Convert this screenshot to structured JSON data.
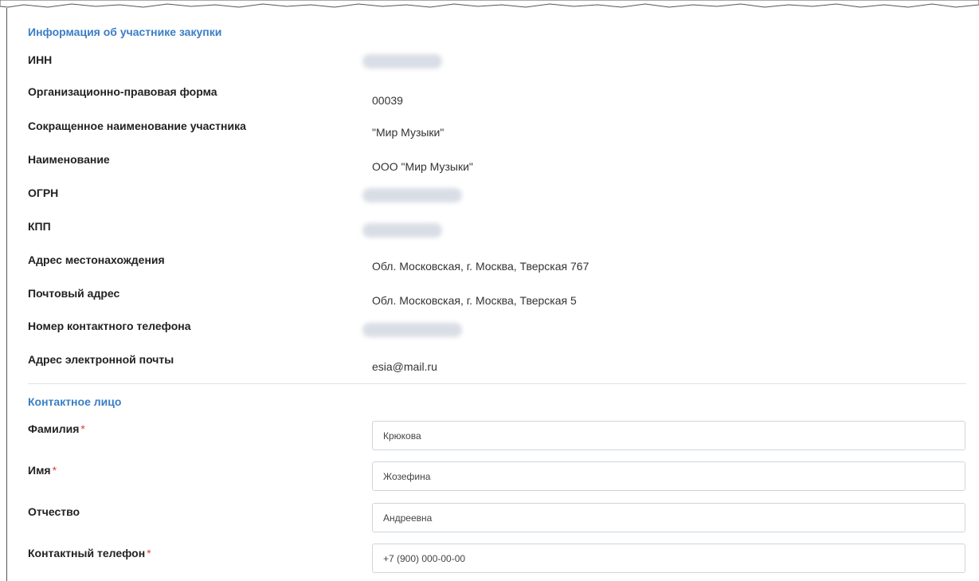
{
  "participant_section": {
    "title": "Информация об участнике закупки",
    "rows": [
      {
        "label": "ИНН",
        "value": "",
        "blurred": true
      },
      {
        "label": "Организационно-правовая форма",
        "value": "00039"
      },
      {
        "label": "Сокращенное наименование участника",
        "value": "\"Мир Музыки\""
      },
      {
        "label": "Наименование",
        "value": "ООО \"Мир Музыки\""
      },
      {
        "label": "ОГРН",
        "value": "",
        "blurred": true
      },
      {
        "label": "КПП",
        "value": "",
        "blurred": true
      },
      {
        "label": "Адрес местонахождения",
        "value": "Обл. Московская, г. Москва, Тверская 767"
      },
      {
        "label": "Почтовый адрес",
        "value": "Обл. Московская, г. Москва, Тверская 5"
      },
      {
        "label": "Номер контактного телефона",
        "value": "",
        "blurred": true
      },
      {
        "label": "Адрес электронной почты",
        "value": "esia@mail.ru"
      }
    ]
  },
  "contact_section": {
    "title": "Контактное лицо",
    "required_mark": "*",
    "fields": [
      {
        "label": "Фамилия",
        "value": "Крюкова",
        "required": true
      },
      {
        "label": "Имя",
        "value": "Жозефина",
        "required": true
      },
      {
        "label": "Отчество",
        "value": "Андреевна",
        "required": false
      },
      {
        "label": "Контактный телефон",
        "value": "+7 (900) 000-00-00",
        "required": true
      }
    ]
  },
  "colors": {
    "section_title": "#3a7ec5",
    "required": "#e03a3a",
    "field_border": "#cfd5dc"
  }
}
